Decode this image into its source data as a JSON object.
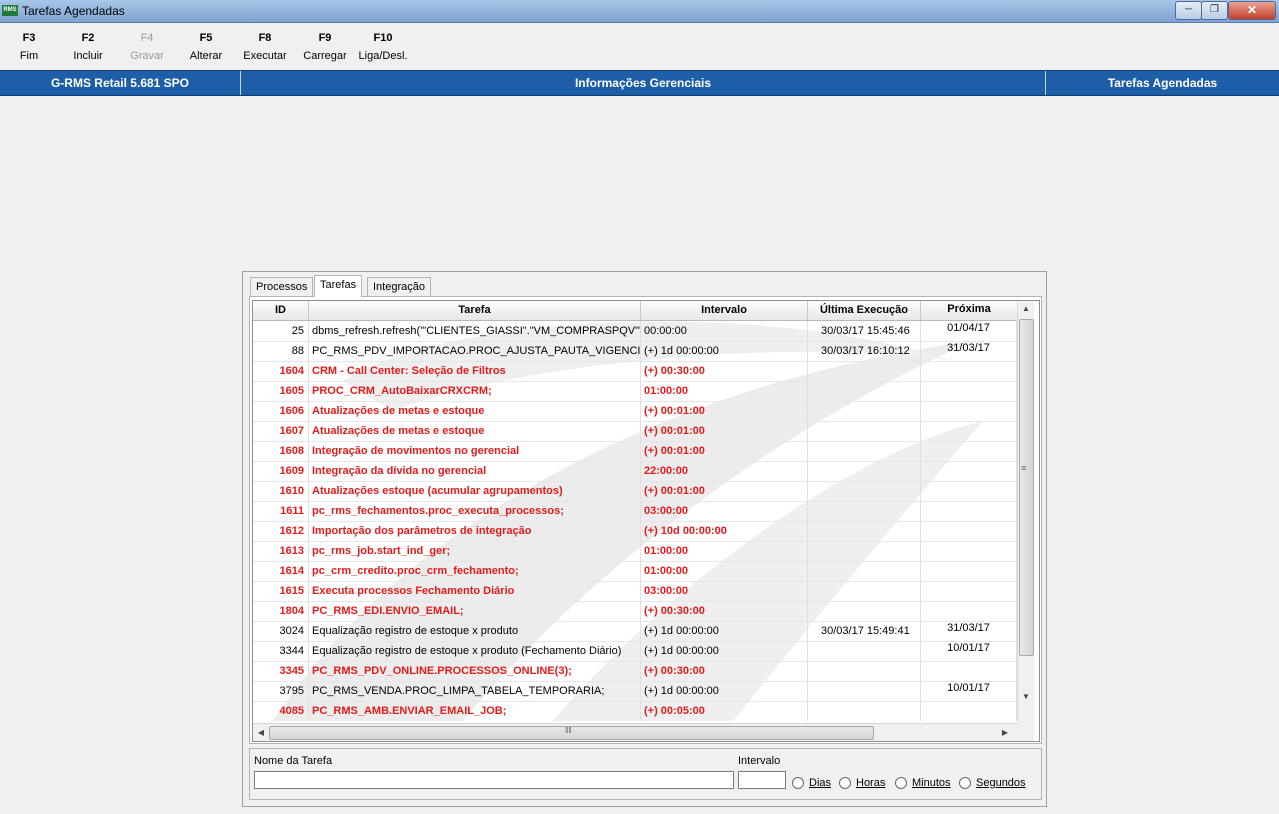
{
  "window": {
    "title": "Tarefas Agendadas",
    "app_icon_text": "RMS"
  },
  "toolbar": [
    {
      "key": "F3",
      "label": "Fim",
      "enabled": true
    },
    {
      "key": "F2",
      "label": "Incluir",
      "enabled": true
    },
    {
      "key": "F4",
      "label": "Gravar",
      "enabled": false
    },
    {
      "key": "F5",
      "label": "Alterar",
      "enabled": true
    },
    {
      "key": "F8",
      "label": "Executar",
      "enabled": true
    },
    {
      "key": "F9",
      "label": "Carregar",
      "enabled": true
    },
    {
      "key": "F10",
      "label": "Liga/Desl.",
      "enabled": true
    }
  ],
  "infobar": {
    "left": "G-RMS Retail 5.681 SPO",
    "center": "Informações Gerenciais",
    "right": "Tarefas Agendadas"
  },
  "tabs": [
    "Processos",
    "Tarefas",
    "Integração"
  ],
  "active_tab": "Tarefas",
  "grid": {
    "headers": {
      "id": "ID",
      "task": "Tarefa",
      "interval": "Intervalo",
      "last": "Última Execução",
      "next": "Próxima"
    },
    "rows": [
      {
        "id": "25",
        "task": "dbms_refresh.refresh('\"CLIENTES_GIASSI\".\"VM_COMPRASPQV\"');",
        "interval": "00:00:00",
        "last": "30/03/17 15:45:46",
        "next": "01/04/17",
        "red": false
      },
      {
        "id": "88",
        "task": "PC_RMS_PDV_IMPORTACAO.PROC_AJUSTA_PAUTA_VIGENCIA;",
        "interval": "(+) 1d 00:00:00",
        "last": "30/03/17 16:10:12",
        "next": "31/03/17",
        "red": false
      },
      {
        "id": "1604",
        "task": "CRM - Call Center: Seleção de Filtros",
        "interval": "(+) 00:30:00",
        "last": "",
        "next": "",
        "red": true
      },
      {
        "id": "1605",
        "task": "PROC_CRM_AutoBaixarCRXCRM;",
        "interval": "01:00:00",
        "last": "",
        "next": "",
        "red": true
      },
      {
        "id": "1606",
        "task": "Atualizações de metas e estoque",
        "interval": "(+) 00:01:00",
        "last": "",
        "next": "",
        "red": true
      },
      {
        "id": "1607",
        "task": "Atualizações de metas e estoque",
        "interval": "(+) 00:01:00",
        "last": "",
        "next": "",
        "red": true
      },
      {
        "id": "1608",
        "task": "Integração de movimentos no gerencial",
        "interval": "(+) 00:01:00",
        "last": "",
        "next": "",
        "red": true
      },
      {
        "id": "1609",
        "task": "Integração da dívida no gerencial",
        "interval": "22:00:00",
        "last": "",
        "next": "",
        "red": true
      },
      {
        "id": "1610",
        "task": "Atualizações estoque (acumular agrupamentos)",
        "interval": "(+) 00:01:00",
        "last": "",
        "next": "",
        "red": true
      },
      {
        "id": "1611",
        "task": "pc_rms_fechamentos.proc_executa_processos;",
        "interval": "03:00:00",
        "last": "",
        "next": "",
        "red": true
      },
      {
        "id": "1612",
        "task": "Importação dos parâmetros de integração",
        "interval": "(+) 10d 00:00:00",
        "last": "",
        "next": "",
        "red": true
      },
      {
        "id": "1613",
        "task": "pc_rms_job.start_ind_ger;",
        "interval": "01:00:00",
        "last": "",
        "next": "",
        "red": true
      },
      {
        "id": "1614",
        "task": "pc_crm_credito.proc_crm_fechamento;",
        "interval": "01:00:00",
        "last": "",
        "next": "",
        "red": true
      },
      {
        "id": "1615",
        "task": "Executa processos Fechamento Diário",
        "interval": "03:00:00",
        "last": "",
        "next": "",
        "red": true
      },
      {
        "id": "1804",
        "task": "PC_RMS_EDI.ENVIO_EMAIL;",
        "interval": "(+) 00:30:00",
        "last": "",
        "next": "",
        "red": true
      },
      {
        "id": "3024",
        "task": "Equalização registro de estoque x produto",
        "interval": "(+) 1d 00:00:00",
        "last": "30/03/17 15:49:41",
        "next": "31/03/17",
        "red": false
      },
      {
        "id": "3344",
        "task": "Equalização registro de estoque x produto (Fechamento Diário)",
        "interval": "(+) 1d 00:00:00",
        "last": "",
        "next": "10/01/17",
        "red": false
      },
      {
        "id": "3345",
        "task": "PC_RMS_PDV_ONLINE.PROCESSOS_ONLINE(3);",
        "interval": "(+) 00:30:00",
        "last": "",
        "next": "",
        "red": true
      },
      {
        "id": "3795",
        "task": "PC_RMS_VENDA.PROC_LIMPA_TABELA_TEMPORARIA;",
        "interval": "(+) 1d 00:00:00",
        "last": "",
        "next": "10/01/17",
        "red": false
      },
      {
        "id": "4085",
        "task": "PC_RMS_AMB.ENVIAR_EMAIL_JOB;",
        "interval": "(+) 00:05:00",
        "last": "",
        "next": "",
        "red": true
      }
    ]
  },
  "form": {
    "name_label": "Nome da Tarefa",
    "name_value": "",
    "interval_label": "Intervalo",
    "interval_value": "",
    "radios": [
      "Dias",
      "Horas",
      "Minutos",
      "Segundos"
    ]
  },
  "colors": {
    "infobar": "#1e5ea8",
    "red_text": "#e31b1b"
  }
}
